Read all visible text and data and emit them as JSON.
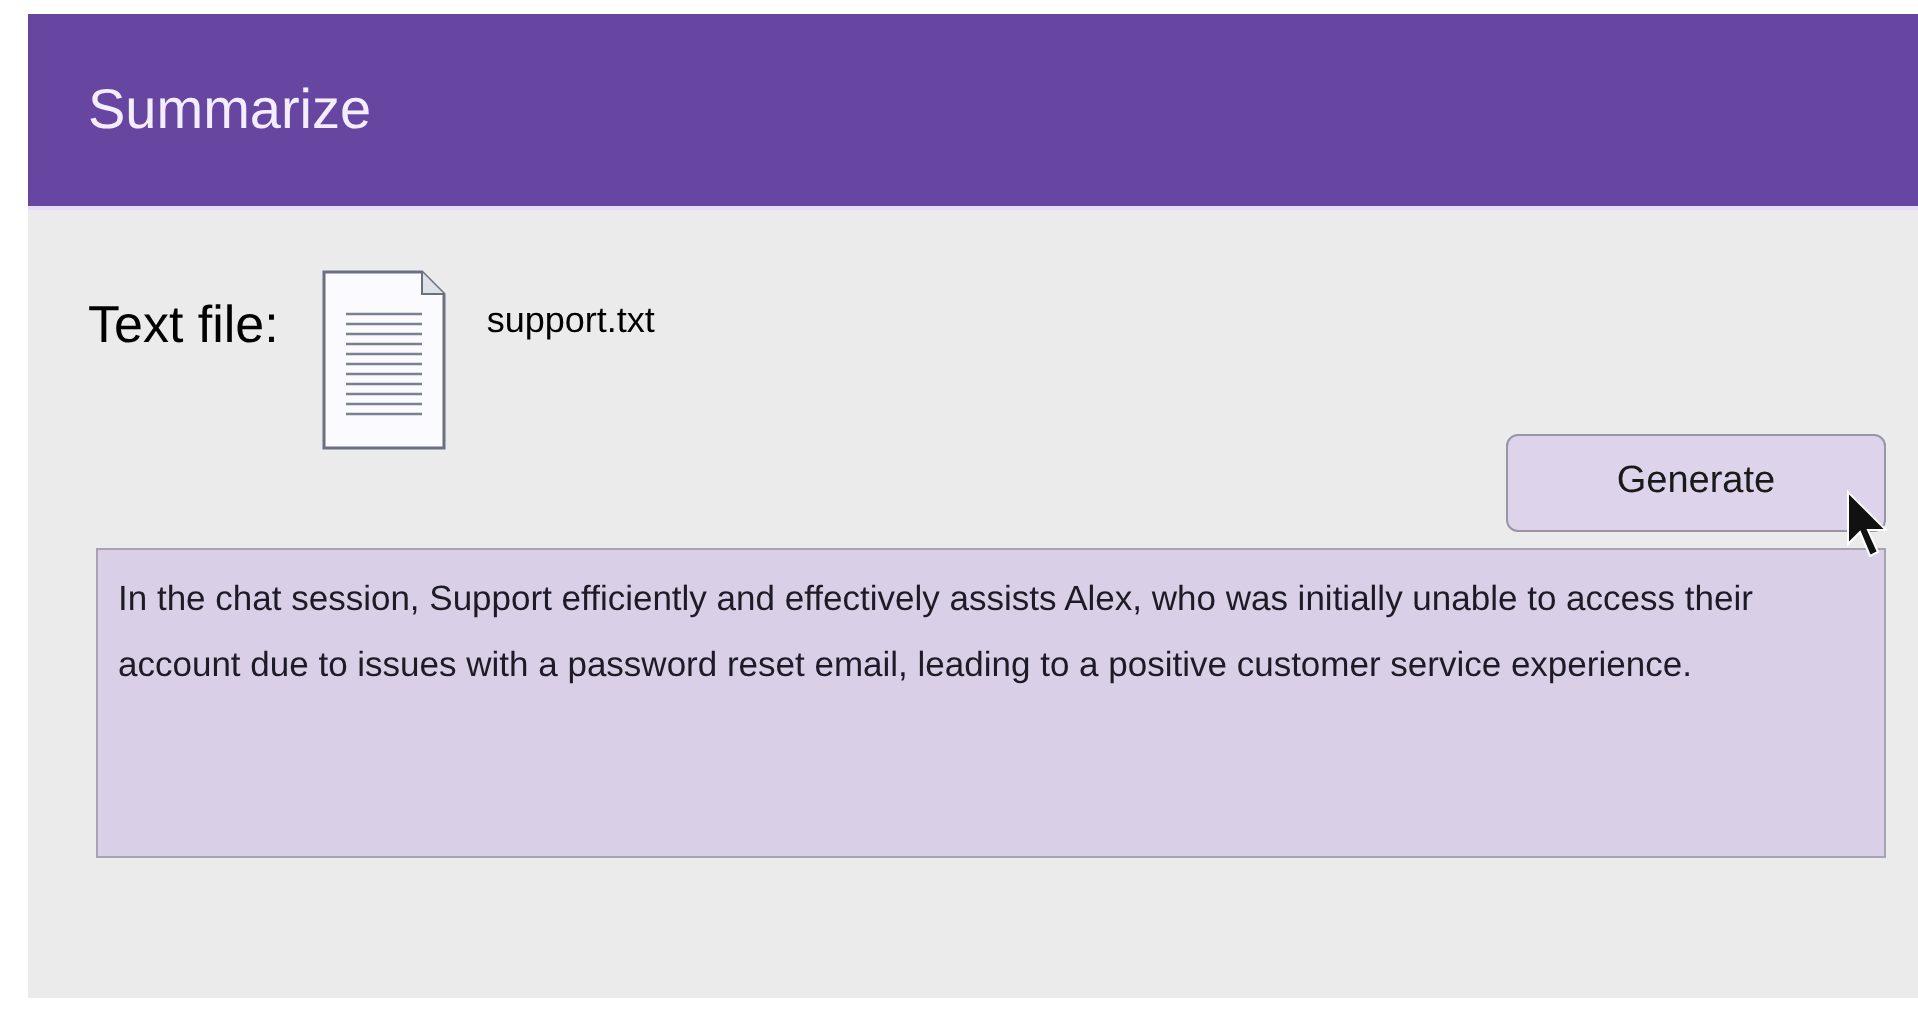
{
  "window": {
    "title": "Summarize"
  },
  "file": {
    "label": "Text file:",
    "name": "support.txt"
  },
  "buttons": [
    {
      "label": "Generate"
    }
  ],
  "summary": {
    "text": "In the chat session, Support efficiently and effectively assists Alex, who was initially unable to access their account due to issues with a password reset email, leading to a positive customer service experience."
  }
}
